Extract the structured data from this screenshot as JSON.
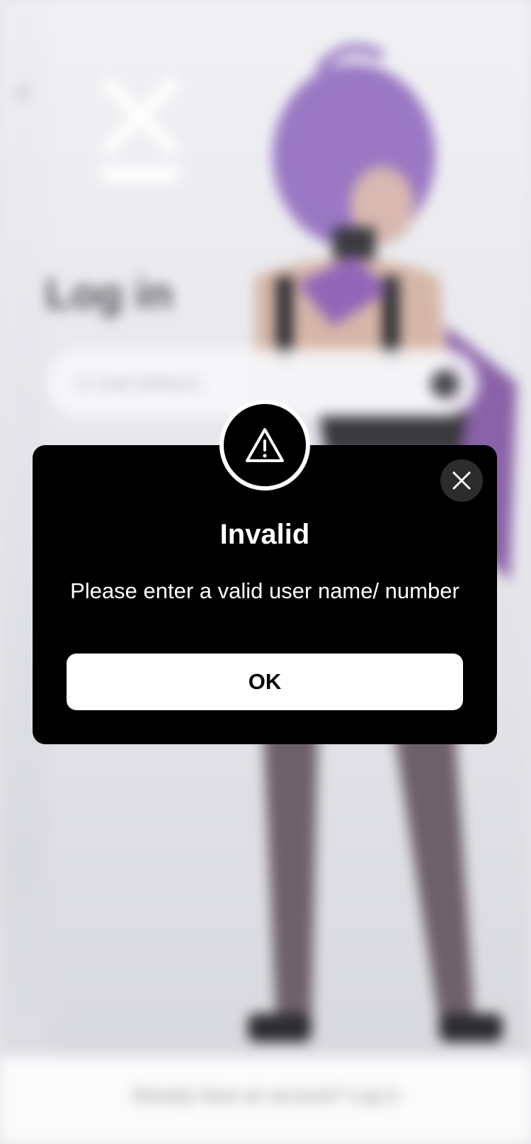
{
  "background": {
    "back_icon": "chevron-left-icon",
    "logo_icon": "x-logo-icon",
    "title": "Log in",
    "email_placeholder": "E-mail Address",
    "footer_text": "Already have an account? Log in"
  },
  "dialog": {
    "icon": "warning-triangle-icon",
    "close_icon": "close-icon",
    "title": "Invalid",
    "message": "Please enter a valid user name/ number",
    "ok_label": "OK"
  },
  "colors": {
    "dialog_background": "#000000",
    "dialog_text": "#ffffff",
    "button_background": "#ffffff",
    "button_text": "#000000",
    "close_button_background": "#2c2c2e",
    "figure_hair": "#9a78c4"
  }
}
